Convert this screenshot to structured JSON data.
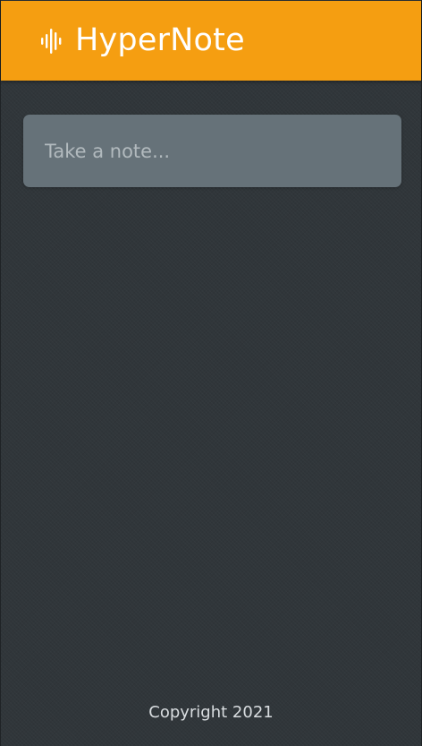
{
  "header": {
    "title": "HyperNote",
    "icon": "audio-wave-icon",
    "background_color": "#f59e11"
  },
  "note_input": {
    "placeholder": "Take a note...",
    "value": ""
  },
  "footer": {
    "copyright": "Copyright 2021"
  },
  "theme": {
    "page_background": "#30363a",
    "input_background": "#667279"
  }
}
